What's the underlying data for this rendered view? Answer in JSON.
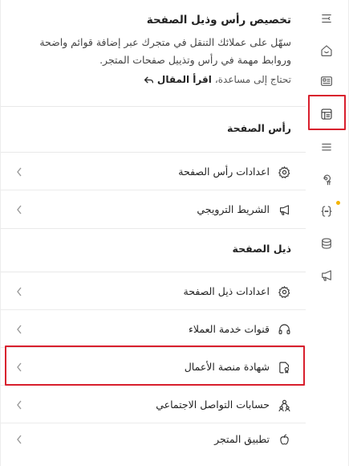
{
  "header": {
    "title": "تخصيص رأس وذيل الصفحة",
    "description_line1": "سهّل على عملائك التنقل في متجرك عبر إضافة قوائم واضحة",
    "description_line2": "وروابط مهمة في رأس وتذييل صفحات المتجر.",
    "help_prefix": "تحتاج إلى مساعدة،",
    "help_link": "اقرأ المقال"
  },
  "sections": {
    "header_section": "رأس الصفحة",
    "footer_section": "ذيل الصفحة"
  },
  "rows": {
    "header_settings": "اعدادات رأس الصفحة",
    "promo_bar": "الشريط الترويجي",
    "footer_settings": "اعدادات ذيل الصفحة",
    "customer_channels": "قنوات خدمة العملاء",
    "business_cert": "شهادة منصة الأعمال",
    "social_accounts": "حسابات التواصل الاجتماعي",
    "store_app": "تطبيق المتجر"
  },
  "colors": {
    "highlight": "#d81f2d",
    "notification_dot": "#f4b400"
  }
}
